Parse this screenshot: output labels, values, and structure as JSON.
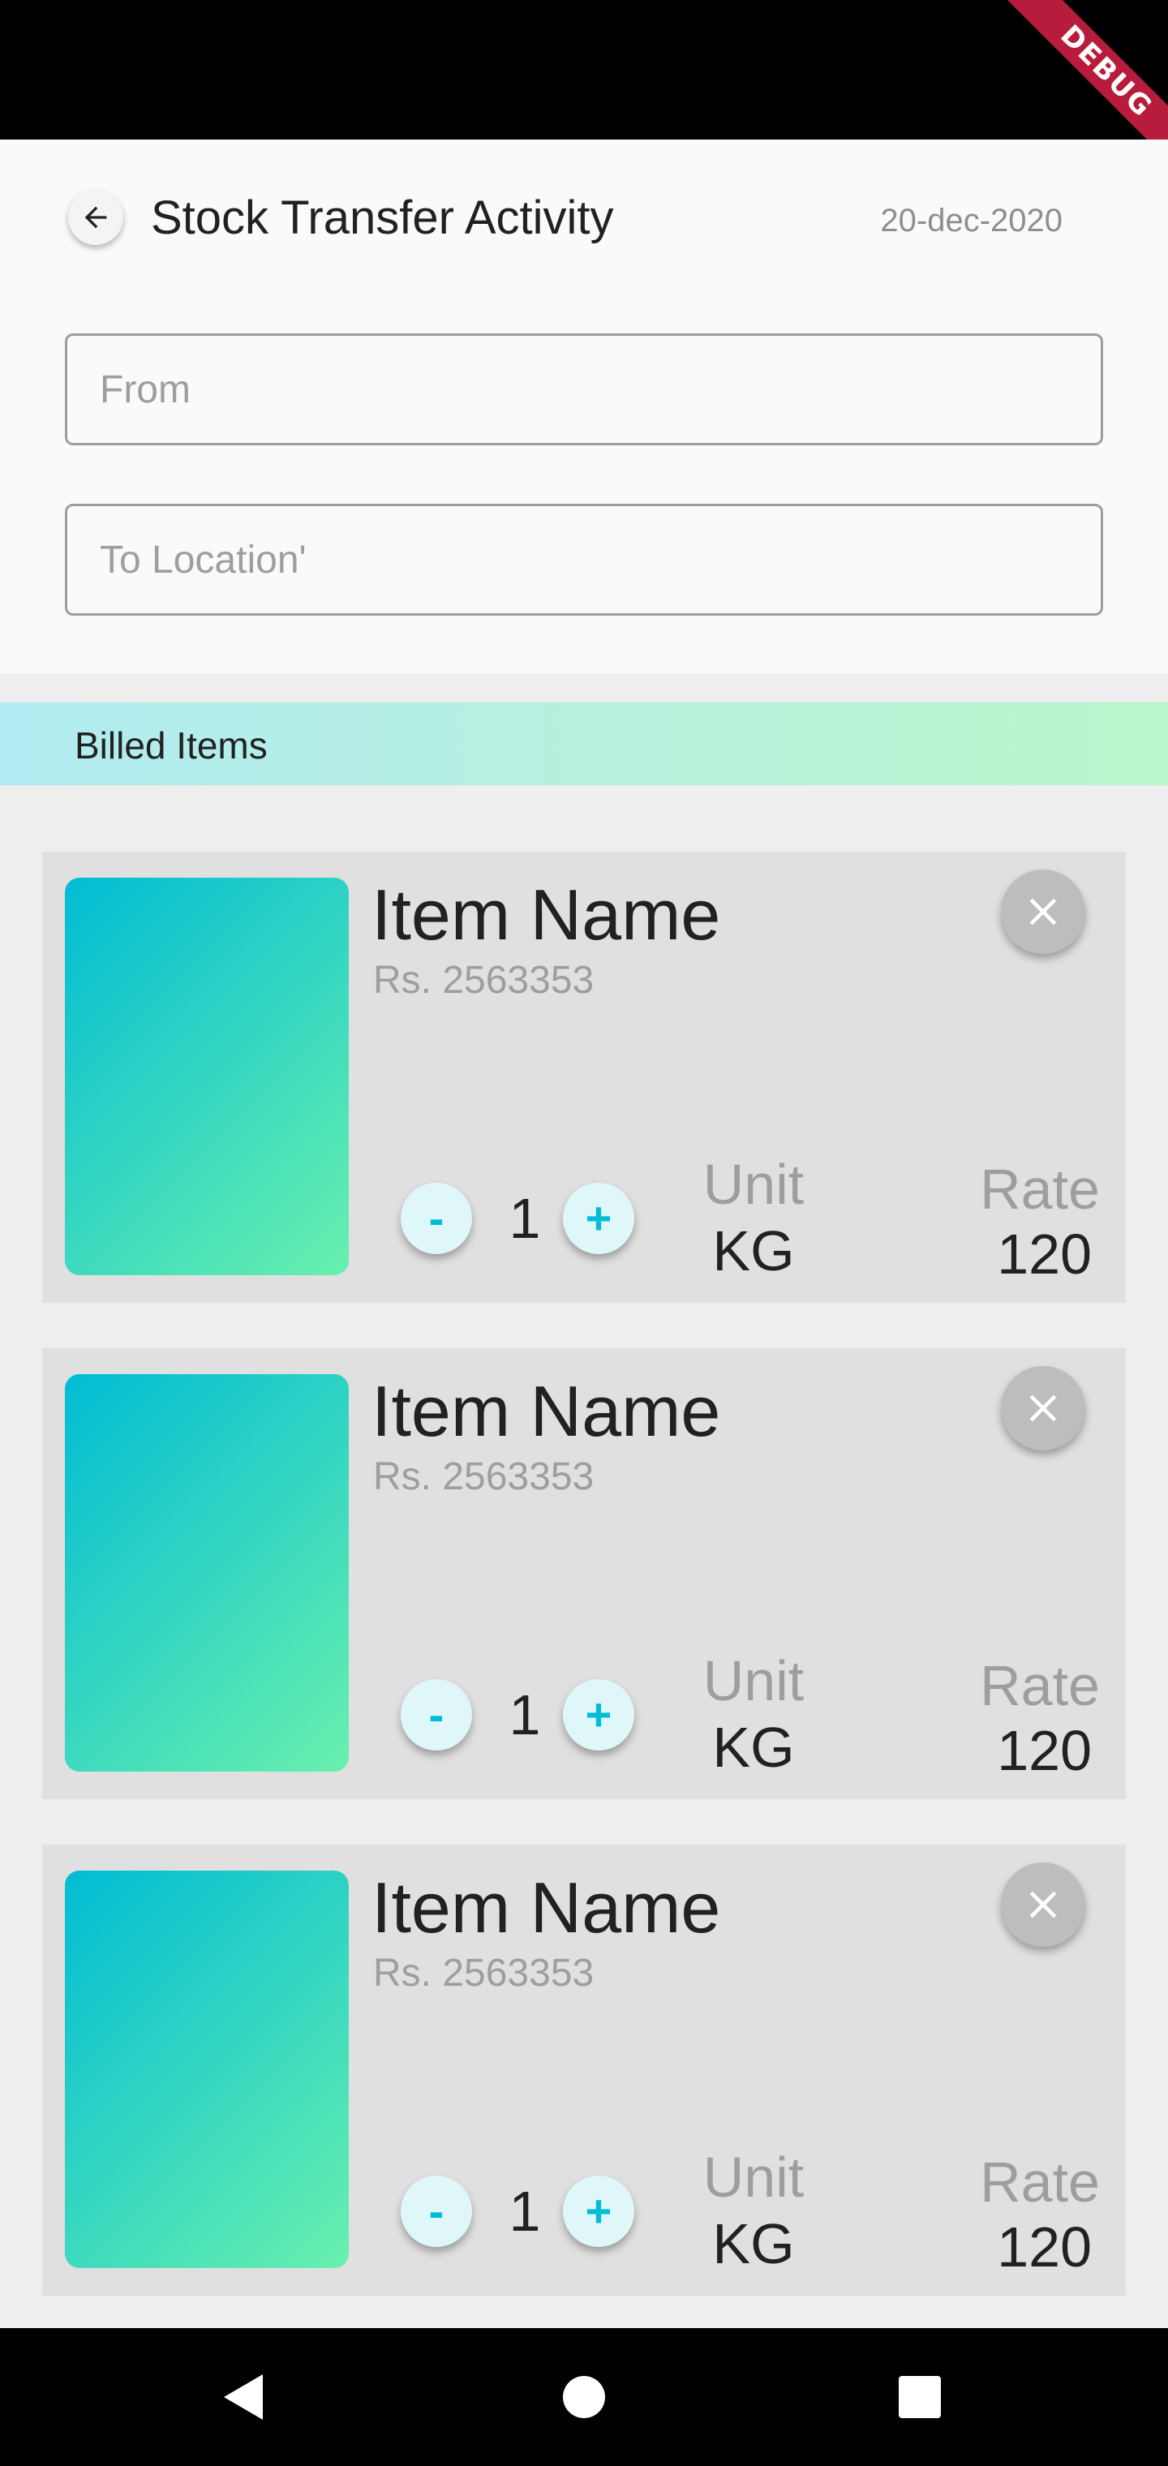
{
  "debug_banner": "DEBUG",
  "header": {
    "title": "Stock Transfer Activity",
    "date": "20-dec-2020"
  },
  "form": {
    "from_placeholder": "From",
    "to_placeholder": "To Location'"
  },
  "billed_items_label": "Billed Items",
  "items": [
    {
      "name": "Item Name",
      "price": "Rs. 2563353",
      "qty": "1",
      "minus_label": "-",
      "plus_label": "+",
      "unit_label": "Unit",
      "unit": "KG",
      "rate_label": "Rate",
      "rate": "120"
    },
    {
      "name": "Item Name",
      "price": "Rs. 2563353",
      "qty": "1",
      "minus_label": "-",
      "plus_label": "+",
      "unit_label": "Unit",
      "unit": "KG",
      "rate_label": "Rate",
      "rate": "120"
    },
    {
      "name": "Item Name",
      "price": "Rs. 2563353",
      "qty": "1",
      "minus_label": "-",
      "plus_label": "+",
      "unit_label": "Unit",
      "unit": "KG",
      "rate_label": "Rate",
      "rate": "120"
    }
  ],
  "icons": {
    "back": "arrow-back-icon",
    "remove": "close-icon",
    "nav_back": "triangle-back-icon",
    "nav_home": "circle-home-icon",
    "nav_recents": "square-recents-icon"
  },
  "colors": {
    "accent": "#00bcd4",
    "accent_light": "#e0f7fa",
    "gradient_start": "#00bcd4",
    "gradient_end": "#69f0ae",
    "banner_start": "#b2ebf2",
    "banner_end": "#b9f6ca",
    "card_bg": "#e0e0e0",
    "debug_ribbon": "#b71c3c"
  }
}
